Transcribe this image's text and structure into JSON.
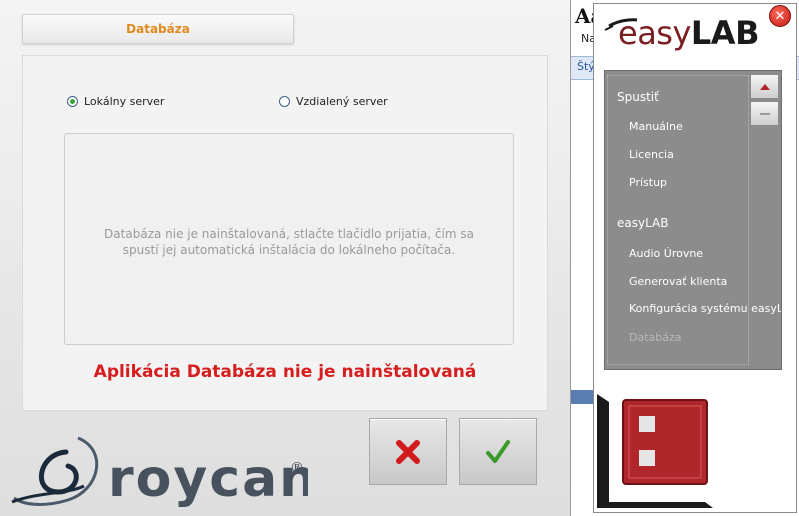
{
  "background_app": {
    "title": "Aa",
    "tab": "Na",
    "style_label": "Štý"
  },
  "dialog": {
    "tab_title": "Databáza",
    "radio_local": "Lokálny server",
    "radio_remote": "Vzdialený server",
    "info_message": "Databáza nie je nainštalovaná, stlačte tlačidlo prijatia, čím sa spustí jej automatická inštalácia do lokálneho počítača.",
    "status_message": "Aplikácia Databáza nie je nainštalovaná",
    "selected_server": "local"
  },
  "logo": {
    "brand": "roycan",
    "mark": "®"
  },
  "side_panel": {
    "brand_easy": "easy",
    "brand_lab": "LAB",
    "menu": [
      {
        "label": "Spustiť",
        "type": "header"
      },
      {
        "label": "Manuálne",
        "type": "item"
      },
      {
        "label": "Licencia",
        "type": "item"
      },
      {
        "label": "Prístup",
        "type": "item"
      },
      {
        "label": "easyLAB",
        "type": "header"
      },
      {
        "label": "Audio Úrovne",
        "type": "item"
      },
      {
        "label": "Generovať klienta",
        "type": "item"
      },
      {
        "label": "Konfigurácia systému easyLAB",
        "type": "item"
      },
      {
        "label": "Databáza",
        "type": "item",
        "active": true
      }
    ]
  },
  "colors": {
    "tab_accent": "#e08a1e",
    "status_red": "#d61e1e",
    "brand_dark_red": "#7a1e22",
    "cancel_red": "#d21a1a",
    "ok_green": "#3a9a2a"
  },
  "icons": {
    "cancel": "x-icon",
    "ok": "checkmark-icon",
    "close": "close-icon",
    "scroll_up": "arrow-up-icon",
    "scroll_down": "arrow-down-icon"
  }
}
